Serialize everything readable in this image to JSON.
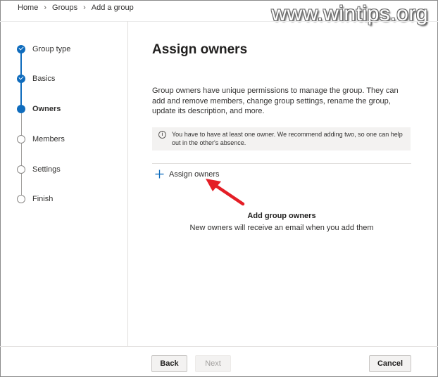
{
  "breadcrumb": {
    "items": [
      "Home",
      "Groups",
      "Add a group"
    ]
  },
  "watermark": "www.wintips.org",
  "stepper": {
    "steps": [
      {
        "label": "Group type",
        "state": "done"
      },
      {
        "label": "Basics",
        "state": "done"
      },
      {
        "label": "Owners",
        "state": "current"
      },
      {
        "label": "Members",
        "state": "todo"
      },
      {
        "label": "Settings",
        "state": "todo"
      },
      {
        "label": "Finish",
        "state": "todo"
      }
    ]
  },
  "main": {
    "title": "Assign owners",
    "description": "Group owners have unique permissions to manage the group. They can add and remove members, change group settings, rename the group, update its description, and more.",
    "info_message": "You have to have at least one owner. We recommend adding two, so one can help out in the other's absence.",
    "assign_button_label": "Assign owners",
    "empty_title": "Add group owners",
    "empty_subtitle": "New owners will receive an email when you add them"
  },
  "footer": {
    "back_label": "Back",
    "next_label": "Next",
    "cancel_label": "Cancel"
  },
  "colors": {
    "accent": "#0f6cbd",
    "annotation_arrow": "#e41e26"
  },
  "icons": {
    "info": "info-icon",
    "plus": "plus-icon",
    "chevron": "chevron-right-icon",
    "check": "checkmark-icon"
  }
}
